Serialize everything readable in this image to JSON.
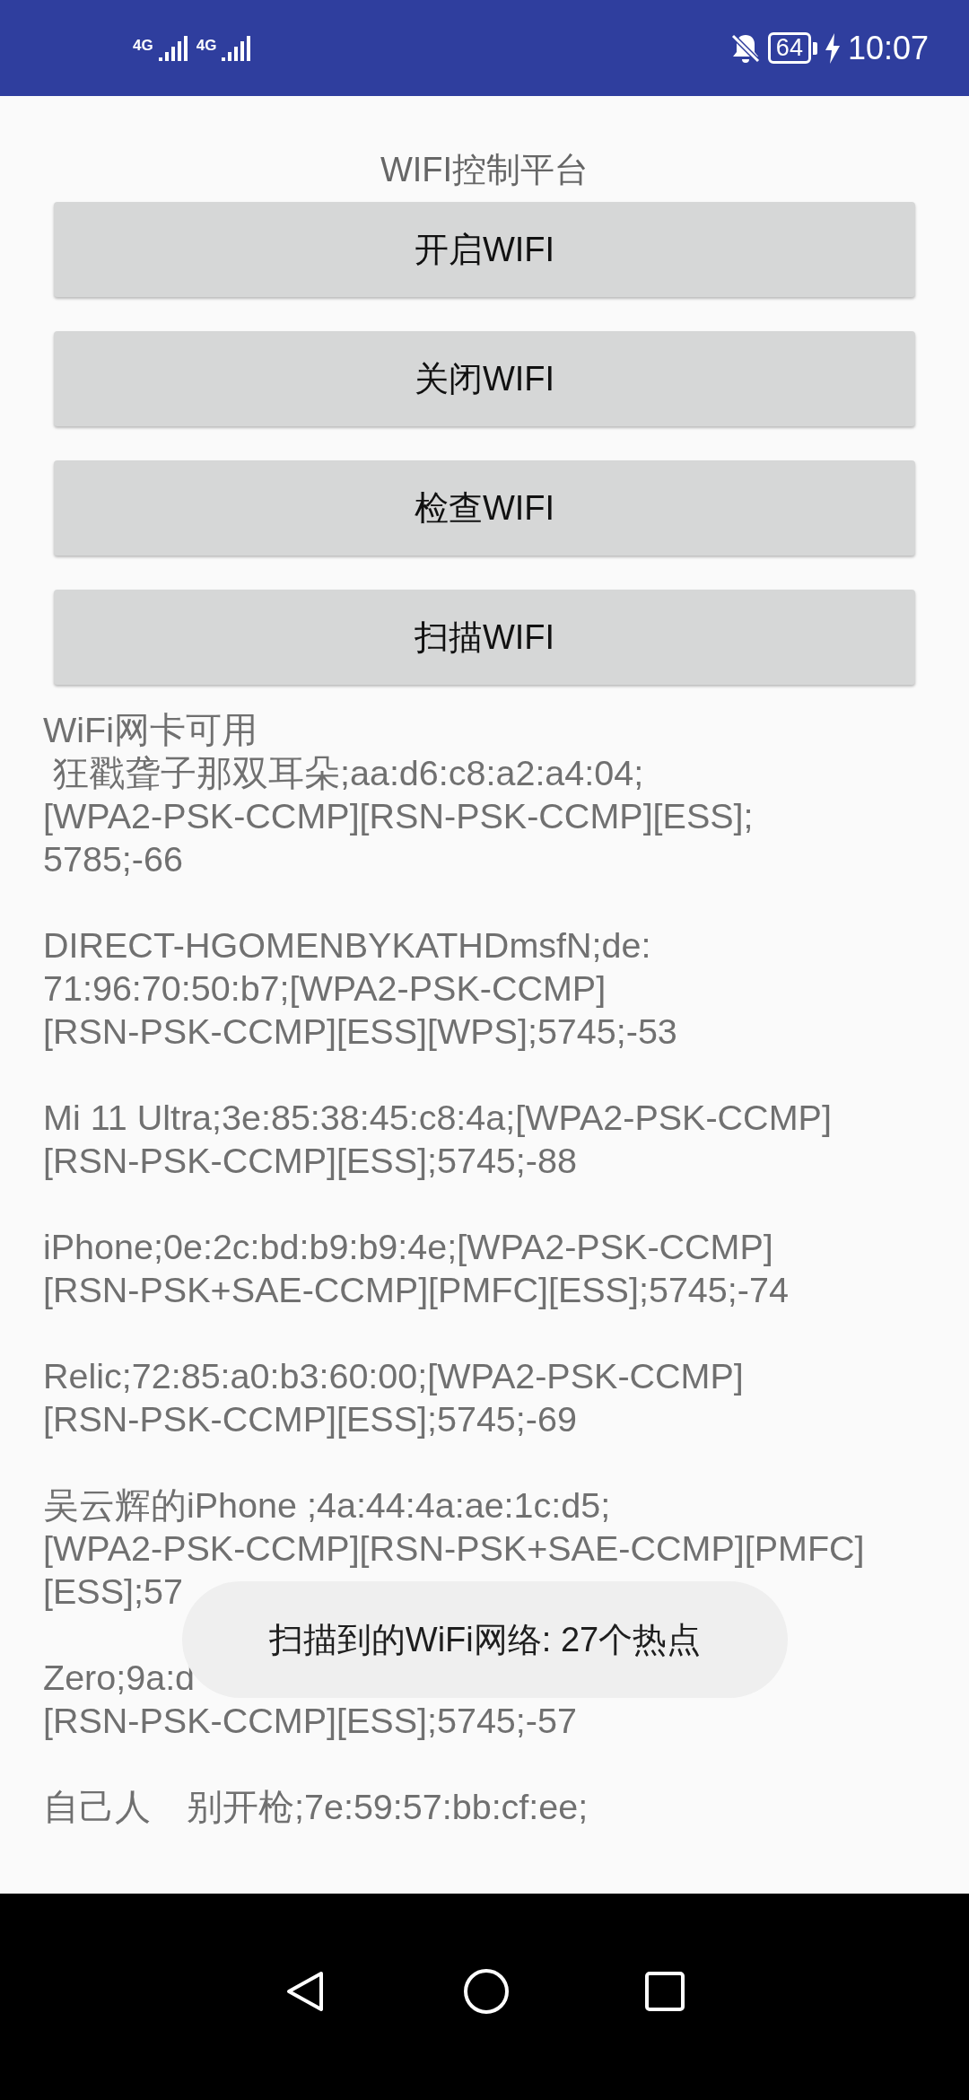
{
  "status_bar": {
    "signal_labels": [
      "4G",
      "4G"
    ],
    "battery": "64",
    "time": "10:07"
  },
  "title": "WIFI控制平台",
  "buttons": [
    "开启WIFI",
    "关闭WIFI",
    "检查WIFI",
    "扫描WIFI"
  ],
  "status_text": "WiFi网卡可用",
  "networks": [
    {
      "lines": [
        " 狂戳聋子那双耳朵;aa:d6:c8:a2:a4:04;",
        "[WPA2-PSK-CCMP][RSN-PSK-CCMP][ESS];",
        "5785;-66"
      ]
    },
    {
      "lines": [
        "DIRECT-HGOMENBYKATHDmsfN;de:",
        "71:96:70:50:b7;[WPA2-PSK-CCMP]",
        "[RSN-PSK-CCMP][ESS][WPS];5745;-53"
      ]
    },
    {
      "lines": [
        "Mi 11 Ultra;3e:85:38:45:c8:4a;[WPA2-PSK-CCMP]",
        "[RSN-PSK-CCMP][ESS];5745;-88"
      ]
    },
    {
      "lines": [
        "iPhone;0e:2c:bd:b9:b9:4e;[WPA2-PSK-CCMP]",
        "[RSN-PSK+SAE-CCMP][PMFC][ESS];5745;-74"
      ]
    },
    {
      "lines": [
        "Relic;72:85:a0:b3:60:00;[WPA2-PSK-CCMP]",
        "[RSN-PSK-CCMP][ESS];5745;-69"
      ]
    },
    {
      "lines": [
        "吴云辉的iPhone ;4a:44:4a:ae:1c:d5;",
        "[WPA2-PSK-CCMP][RSN-PSK+SAE-CCMP][PMFC]",
        "[ESS];57"
      ]
    },
    {
      "lines": [
        "Zero;9a:d",
        "[RSN-PSK-CCMP][ESS];5745;-57"
      ]
    },
    {
      "lines": [
        "自己人　别开枪;7e:59:57:bb:cf:ee;"
      ]
    }
  ],
  "toast": "扫描到的WiFi网络: 27个热点"
}
